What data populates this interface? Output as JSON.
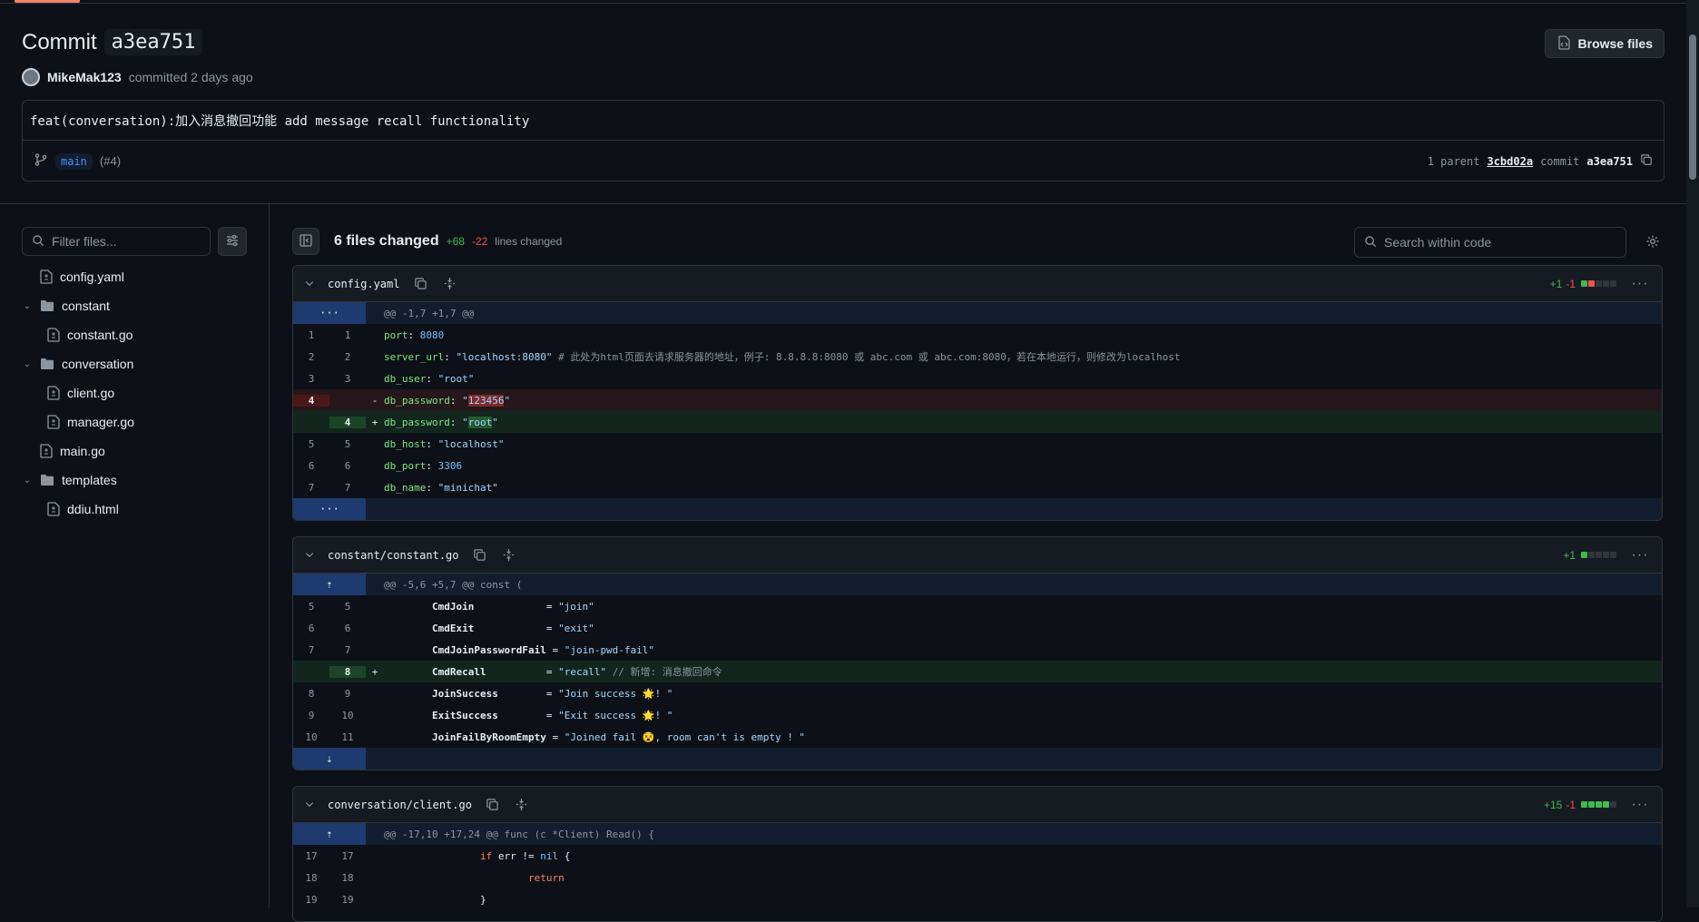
{
  "header": {
    "title_prefix": "Commit",
    "short_sha": "a3ea751",
    "browse_label": "Browse files",
    "author": "MikeMak123",
    "committed_text": "committed 2 days ago"
  },
  "message": {
    "text": "feat(conversation):加入消息撤回功能 add message recall functionality",
    "branch": "main",
    "pr_ref": "(#4)",
    "parent_label": "1 parent",
    "parent_sha": "3cbd02a",
    "commit_label": "commit",
    "commit_sha": "a3ea751"
  },
  "sidebar": {
    "filter_placeholder": "Filter files...",
    "tree": [
      {
        "label": "config.yaml",
        "type": "file",
        "depth": 0
      },
      {
        "label": "constant",
        "type": "folder",
        "depth": 0
      },
      {
        "label": "constant.go",
        "type": "file",
        "depth": 1
      },
      {
        "label": "conversation",
        "type": "folder",
        "depth": 0
      },
      {
        "label": "client.go",
        "type": "file",
        "depth": 1
      },
      {
        "label": "manager.go",
        "type": "file",
        "depth": 1
      },
      {
        "label": "main.go",
        "type": "file",
        "depth": 0
      },
      {
        "label": "templates",
        "type": "folder",
        "depth": 0
      },
      {
        "label": "ddiu.html",
        "type": "file",
        "depth": 1
      }
    ]
  },
  "toolbar": {
    "files_changed": "6 files changed",
    "additions": "+68",
    "deletions": "-22",
    "lines_changed": "lines changed",
    "search_placeholder": "Search within code"
  },
  "files": [
    {
      "name": "config.yaml",
      "stat_add": "+1",
      "stat_del": "-1",
      "hunk": "@@ -1,7 +1,7 @@"
    },
    {
      "name": "constant/constant.go",
      "stat_add": "+1",
      "stat_del": "",
      "hunk": "@@ -5,6 +5,7 @@ const ("
    },
    {
      "name": "conversation/client.go",
      "stat_add": "+15",
      "stat_del": "-1",
      "hunk": "@@ -17,10 +17,24 @@ func (c *Client) Read() {"
    }
  ],
  "colors": {
    "accent": "#f78166",
    "add": "#3fb950",
    "del": "#f85149",
    "link": "#4493f8"
  }
}
